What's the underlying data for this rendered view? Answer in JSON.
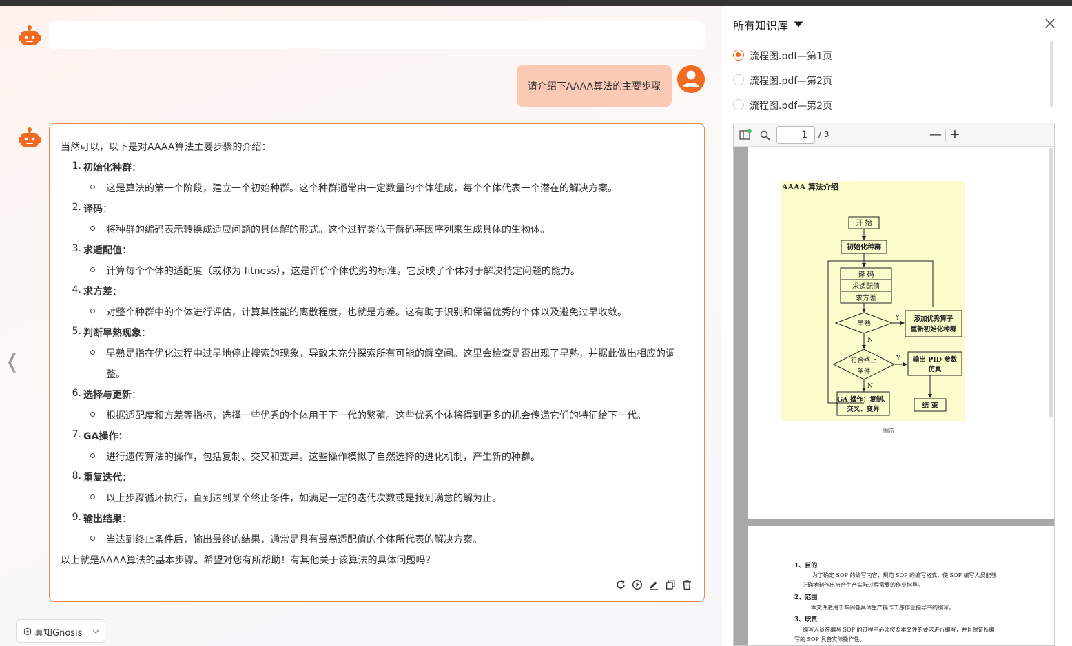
{
  "header": {
    "bar_color": "#333333"
  },
  "chat": {
    "user_message": "请介绍下AAAA算法的主要步骤",
    "answer": {
      "intro": "当然可以，以下是对AAAA算法主要步骤的介绍：",
      "steps": [
        {
          "num": "1.",
          "title": "初始化种群",
          "desc": "这是算法的第一个阶段，建立一个初始种群。这个种群通常由一定数量的个体组成，每个个体代表一个潜在的解决方案。"
        },
        {
          "num": "2.",
          "title": "译码",
          "desc": "将种群的编码表示转换成适应问题的具体解的形式。这个过程类似于解码基因序列来生成具体的生物体。"
        },
        {
          "num": "3.",
          "title": "求适配值",
          "desc": "计算每个个体的适配度（或称为 fitness），这是评价个体优劣的标准。它反映了个体对于解决特定问题的能力。"
        },
        {
          "num": "4.",
          "title": "求方差",
          "desc": "对整个种群中的个体进行评估，计算其性能的离散程度，也就是方差。这有助于识别和保留优秀的个体以及避免过早收敛。"
        },
        {
          "num": "5.",
          "title": "判断早熟现象",
          "desc": "早熟是指在优化过程中过早地停止搜索的现象，导致未充分探索所有可能的解空间。这里会检查是否出现了早熟，并据此做出相应的调",
          "desc2": "整。"
        },
        {
          "num": "6.",
          "title": "选择与更新",
          "desc": "根据适配度和方差等指标，选择一些优秀的个体用于下一代的繁殖。这些优秀个体将得到更多的机会传递它们的特征给下一代。"
        },
        {
          "num": "7.",
          "title": "GA操作",
          "desc": "进行遗传算法的操作，包括复制、交叉和变异。这些操作模拟了自然选择的进化机制，产生新的种群。"
        },
        {
          "num": "8.",
          "title": "重复迭代",
          "desc": "以上步骤循环执行，直到达到某个终止条件，如满足一定的迭代次数或是找到满意的解为止。"
        },
        {
          "num": "9.",
          "title": "输出结果",
          "desc": "当达到终止条件后，输出最终的结果，通常是具有最高适配值的个体所代表的解决方案。"
        }
      ],
      "colon": "：",
      "outro": "以上就是AAAA算法的基本步骤。希望对您有所帮助！有其他关于该算法的具体问题吗？"
    },
    "actions": [
      "refresh-icon",
      "play-icon",
      "edit-icon",
      "copy-icon",
      "delete-icon"
    ],
    "collapse_glyph": "❬",
    "model_selector": "真知Gnosis",
    "accent": "#f26a1f"
  },
  "panel": {
    "title": "所有知识库",
    "sources": [
      {
        "label": "流程图.pdf—第1页",
        "selected": true
      },
      {
        "label": "流程图.pdf—第2页",
        "selected": false
      },
      {
        "label": "流程图.pdf—第2页",
        "selected": false
      }
    ],
    "pdf": {
      "page_number": "1",
      "page_total": "/ 3",
      "zoom_out": "—",
      "zoom_in": "+",
      "page1": {
        "heading": "AAAA 算法介绍",
        "caption": "图示",
        "nodes": {
          "start": "开 始",
          "init": "初始化种群",
          "decode": "译 码",
          "fitness": "求适配值",
          "variance": "求方差",
          "premature": "早熟",
          "add": "添加优秀算子",
          "reinit": "重新初始化种群",
          "terminate1": "符合终止",
          "terminate2": "条件",
          "output1": "输出 PID 参数",
          "output2": "仿真",
          "ga1": "GA 操作：复制、",
          "ga2": "交叉、变异",
          "end": "结 束",
          "yes": "Y",
          "no": "N"
        }
      },
      "page2": {
        "h1": "1、目的",
        "t1a": "为了确定 SOP 的编写内容，规范 SOP 的编写格式，使 SOP 编写人员能够",
        "t1b": "正确地制作出符合生产实际过程需要的作业指导。",
        "h2": "2、范围",
        "t2": "本文件适用于车间各具体生产操作工序作业指导书的编写。",
        "h3": "3、职责",
        "t3a": "编写人员在编写 SOP 的过程中必须按照本文件的要求进行编写，并且保证所编",
        "t3b": "写的 SOP 具备实际操作性。"
      }
    }
  }
}
